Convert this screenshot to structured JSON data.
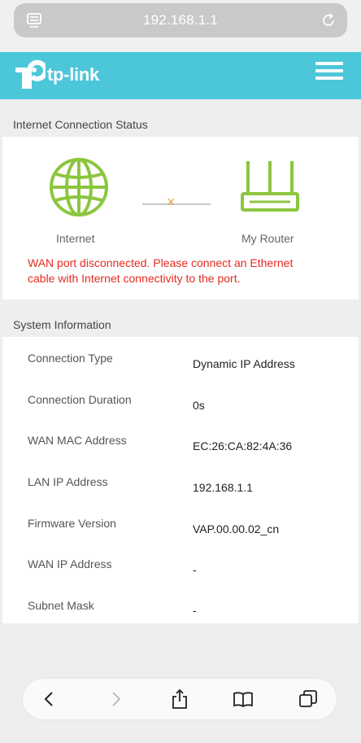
{
  "browser": {
    "url": "192.168.1.1"
  },
  "header": {
    "brand": "tp-link",
    "brand_color": "#4cc6d9"
  },
  "status": {
    "section_title": "Internet Connection Status",
    "internet_label": "Internet",
    "router_label": "My Router",
    "link_state_glyph": "×",
    "warning": "WAN port disconnected. Please connect an Ethernet cable with Internet connectivity to the port.",
    "warning_color": "#e52a20",
    "icon_color": "#8cc63f"
  },
  "system": {
    "section_title": "System Information",
    "rows": [
      {
        "label": "Connection Type",
        "value": "Dynamic IP Address"
      },
      {
        "label": "Connection Duration",
        "value": "0s"
      },
      {
        "label": "WAN MAC Address",
        "value": "EC:26:CA:82:4A:36"
      },
      {
        "label": "LAN IP Address",
        "value": "192.168.1.1"
      },
      {
        "label": "Firmware Version",
        "value": "VAP.00.00.02_cn"
      },
      {
        "label": "WAN IP Address",
        "value": "-"
      },
      {
        "label": "Subnet Mask",
        "value": "-"
      }
    ]
  },
  "toolbar": {
    "icons": [
      "back-icon",
      "forward-icon",
      "share-icon",
      "bookmarks-icon",
      "tabs-icon"
    ]
  }
}
